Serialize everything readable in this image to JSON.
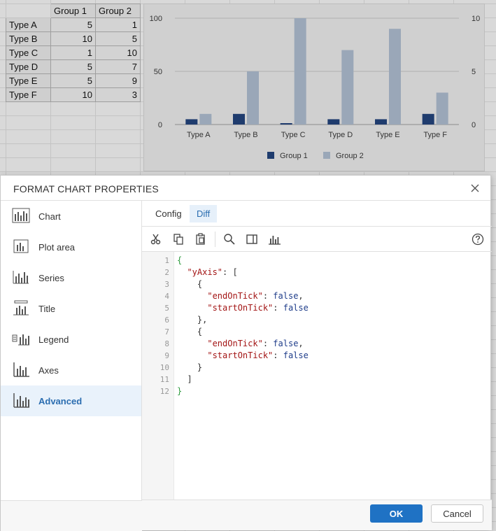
{
  "sheet": {
    "headers": [
      "Group 1",
      "Group 2"
    ],
    "rows": [
      {
        "label": "Type A",
        "g1": "5",
        "g2": "1"
      },
      {
        "label": "Type B",
        "g1": "10",
        "g2": "5"
      },
      {
        "label": "Type C",
        "g1": "1",
        "g2": "10"
      },
      {
        "label": "Type D",
        "g1": "5",
        "g2": "7"
      },
      {
        "label": "Type E",
        "g1": "5",
        "g2": "9"
      },
      {
        "label": "Type F",
        "g1": "10",
        "g2": "3"
      }
    ]
  },
  "chart_data": {
    "type": "bar",
    "categories": [
      "Type A",
      "Type B",
      "Type C",
      "Type D",
      "Type E",
      "Type F"
    ],
    "series": [
      {
        "name": "Group 1",
        "values": [
          5,
          10,
          1,
          5,
          5,
          10
        ],
        "color": "#1f3c6e",
        "axis": "left"
      },
      {
        "name": "Group 2",
        "values": [
          1,
          5,
          10,
          7,
          9,
          3
        ],
        "color": "#9aa7b8",
        "axis": "right"
      }
    ],
    "y_left_ticks": [
      "0",
      "50",
      "100"
    ],
    "y_right_ticks": [
      "0",
      "5",
      "10"
    ],
    "ylim_left": [
      0,
      100
    ],
    "ylim_right": [
      0,
      10
    ],
    "legend_position": "bottom"
  },
  "dialog": {
    "title": "FORMAT CHART PROPERTIES",
    "sidebar": [
      {
        "label": "Chart"
      },
      {
        "label": "Plot area"
      },
      {
        "label": "Series"
      },
      {
        "label": "Title"
      },
      {
        "label": "Legend"
      },
      {
        "label": "Axes"
      },
      {
        "label": "Advanced"
      }
    ],
    "active_item": "Advanced",
    "tabs": [
      {
        "label": "Config"
      },
      {
        "label": "Diff"
      }
    ],
    "active_tab": "Diff",
    "code_lines": [
      "{",
      "  \"yAxis\": [",
      "    {",
      "      \"endOnTick\": false,",
      "      \"startOnTick\": false",
      "    },",
      "    {",
      "      \"endOnTick\": false,",
      "      \"startOnTick\": false",
      "    }",
      "  ]",
      "}"
    ],
    "ok_label": "OK",
    "cancel_label": "Cancel"
  }
}
